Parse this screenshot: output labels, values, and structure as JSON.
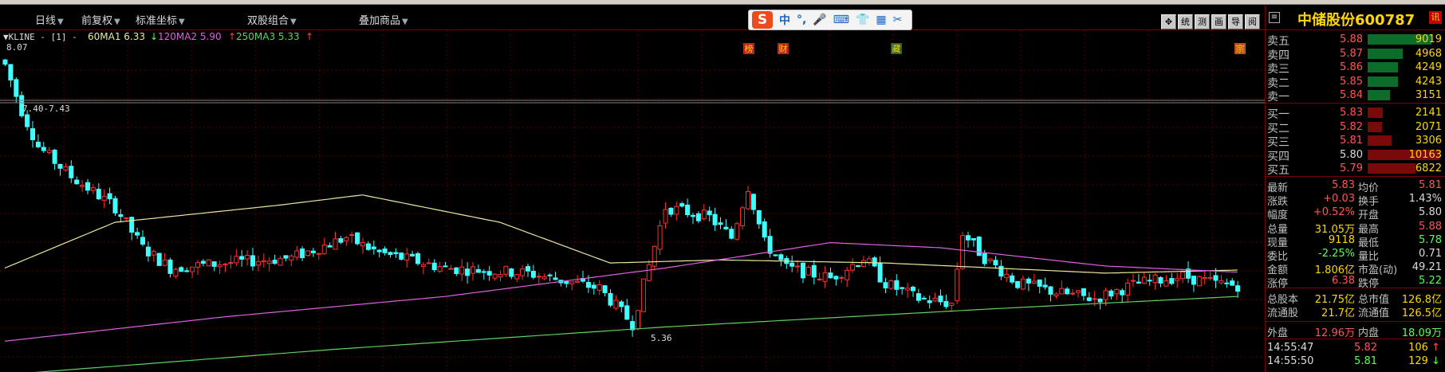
{
  "toolbar": {
    "items": [
      "日线",
      "前复权",
      "标准坐标",
      "双股组合",
      "叠加商品"
    ],
    "ime": {
      "chars": [
        "中",
        "°,",
        "🎤",
        "⌨",
        "👕",
        "▦",
        "✂"
      ]
    },
    "tools": [
      "✥",
      "统",
      "测",
      "画",
      "导",
      "阅"
    ]
  },
  "chart": {
    "legend": {
      "name": "▼KLINE - [1] -",
      "ma60": "60MA1 6.33",
      "ma60_arrow": "↓",
      "ma120": "120MA2 5.90",
      "ma120_arrow": "↑",
      "ma250": "250MA3 5.33",
      "ma250_arrow": "↑"
    },
    "top_label": "8.07",
    "range_label": "7.40-7.43",
    "low_label": "5.36",
    "tags": [
      "榜",
      "财",
      "藏",
      "宗"
    ]
  },
  "chart_data": {
    "type": "candlestick",
    "ma_series": [
      {
        "name": "60MA1",
        "value": 6.33,
        "color": "#e8e8a0"
      },
      {
        "name": "120MA2",
        "value": 5.9,
        "color": "#e060e0"
      },
      {
        "name": "250MA3",
        "value": 5.33,
        "color": "#60d060"
      }
    ],
    "up_color": "#ff3030",
    "down_color": "#40ffff",
    "ylim": [
      5.0,
      8.2
    ],
    "marked_high": 8.07,
    "marked_low": 5.36
  },
  "panel": {
    "header_icon": "≡",
    "title": "中储股份600787",
    "badge": "讯",
    "asks": [
      {
        "label": "卖五",
        "price": "5.88",
        "vol": "9019",
        "frac": 0.89
      },
      {
        "label": "卖四",
        "price": "5.87",
        "vol": "4968",
        "frac": 0.49
      },
      {
        "label": "卖三",
        "price": "5.86",
        "vol": "4249",
        "frac": 0.42
      },
      {
        "label": "卖二",
        "price": "5.85",
        "vol": "4243",
        "frac": 0.42
      },
      {
        "label": "卖一",
        "price": "5.84",
        "vol": "3151",
        "frac": 0.31
      }
    ],
    "bids": [
      {
        "label": "买一",
        "price": "5.83",
        "vol": "2141",
        "frac": 0.21
      },
      {
        "label": "买二",
        "price": "5.82",
        "vol": "2071",
        "frac": 0.2
      },
      {
        "label": "买三",
        "price": "5.81",
        "vol": "3306",
        "frac": 0.33
      },
      {
        "label": "买四",
        "price": "5.80",
        "vol": "10163",
        "frac": 1.0
      },
      {
        "label": "买五",
        "price": "5.79",
        "vol": "6822",
        "frac": 0.67
      }
    ],
    "stats": [
      {
        "l1": "最新",
        "v1": "5.83",
        "c1": "red",
        "l2": "均价",
        "v2": "5.81",
        "c2": "red"
      },
      {
        "l1": "涨跌",
        "v1": "+0.03",
        "c1": "red",
        "l2": "换手",
        "v2": "1.43%",
        "c2": "wht"
      },
      {
        "l1": "幅度",
        "v1": "+0.52%",
        "c1": "red",
        "l2": "开盘",
        "v2": "5.80",
        "c2": "wht"
      },
      {
        "l1": "总量",
        "v1": "31.05万",
        "c1": "yel",
        "l2": "最高",
        "v2": "5.88",
        "c2": "red"
      },
      {
        "l1": "现量",
        "v1": "9118",
        "c1": "yel",
        "l2": "最低",
        "v2": "5.78",
        "c2": "grn"
      },
      {
        "l1": "委比",
        "v1": "-2.25%",
        "c1": "grn",
        "l2": "量比",
        "v2": "0.71",
        "c2": "wht"
      },
      {
        "l1": "金额",
        "v1": "1.806亿",
        "c1": "yel",
        "l2": "市盈(动)",
        "v2": "49.21",
        "c2": "wht"
      },
      {
        "l1": "涨停",
        "v1": "6.38",
        "c1": "red",
        "l2": "跌停",
        "v2": "5.22",
        "c2": "grn"
      }
    ],
    "caps": [
      {
        "l1": "总股本",
        "v1": "21.75亿",
        "l2": "总市值",
        "v2": "126.8亿"
      },
      {
        "l1": "流通股",
        "v1": "21.7亿",
        "l2": "流通值",
        "v2": "126.5亿"
      }
    ],
    "outer_label": "外盘",
    "outer_value": "12.96万",
    "inner_label": "内盘",
    "inner_value": "18.09万",
    "ticks": [
      {
        "time": "14:55:47",
        "price": "5.82",
        "vol": "106",
        "dir": "↑",
        "c": "red"
      },
      {
        "time": "14:55:50",
        "price": "5.81",
        "vol": "129",
        "dir": "↓",
        "c": "grn"
      }
    ]
  }
}
